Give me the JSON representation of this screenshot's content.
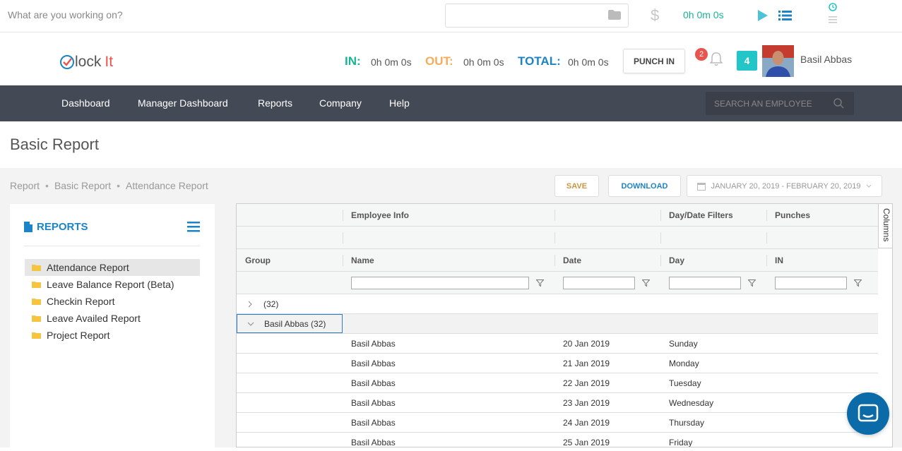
{
  "timer": {
    "placeholder": "What are you working on?",
    "time": "0h 0m 0s"
  },
  "header": {
    "logo_main": "lock",
    "logo_it": "It",
    "in_label": "IN:",
    "in_value": "0h 0m 0s",
    "out_label": "OUT:",
    "out_value": "0h 0m 0s",
    "total_label": "TOTAL:",
    "total_value": "0h 0m 0s",
    "punch_label": "PUNCH IN",
    "notification_count": "2",
    "count_badge": "4",
    "user_name": "Basil Abbas"
  },
  "nav": {
    "items": [
      "Dashboard",
      "Manager Dashboard",
      "Reports",
      "Company",
      "Help"
    ],
    "search_placeholder": "SEARCH AN EMPLOYEE"
  },
  "page": {
    "title": "Basic Report"
  },
  "breadcrumb": [
    "Report",
    "Basic Report",
    "Attendance Report"
  ],
  "toolbar": {
    "save_label": "SAVE",
    "download_label": "DOWNLOAD",
    "date_range": "JANUARY 20, 2019 - FEBRUARY 20, 2019"
  },
  "sidebar": {
    "title": "REPORTS",
    "items": [
      "Attendance Report",
      "Leave Balance Report (Beta)",
      "Checkin Report",
      "Leave Availed Report",
      "Project Report"
    ],
    "active_index": 0
  },
  "grid": {
    "group_headers": [
      "Employee Info",
      "Day/Date Filters",
      "Punches"
    ],
    "columns": [
      "Group",
      "Name",
      "Date",
      "Day",
      "IN"
    ],
    "columns_tab": "Columns",
    "groups": [
      {
        "label": "(32)"
      },
      {
        "label": "Basil Abbas (32)"
      }
    ],
    "rows": [
      {
        "name": "Basil Abbas",
        "date": "20 Jan 2019",
        "day": "Sunday"
      },
      {
        "name": "Basil Abbas",
        "date": "21 Jan 2019",
        "day": "Monday"
      },
      {
        "name": "Basil Abbas",
        "date": "22 Jan 2019",
        "day": "Tuesday"
      },
      {
        "name": "Basil Abbas",
        "date": "23 Jan 2019",
        "day": "Wednesday"
      },
      {
        "name": "Basil Abbas",
        "date": "24 Jan 2019",
        "day": "Thursday"
      },
      {
        "name": "Basil Abbas",
        "date": "25 Jan 2019",
        "day": "Friday"
      }
    ]
  },
  "colors": {
    "in": "#1ab394",
    "out": "#f8ac59",
    "total": "#1c84c6",
    "nav_bg": "#444a55",
    "accent": "#23c6c8"
  }
}
